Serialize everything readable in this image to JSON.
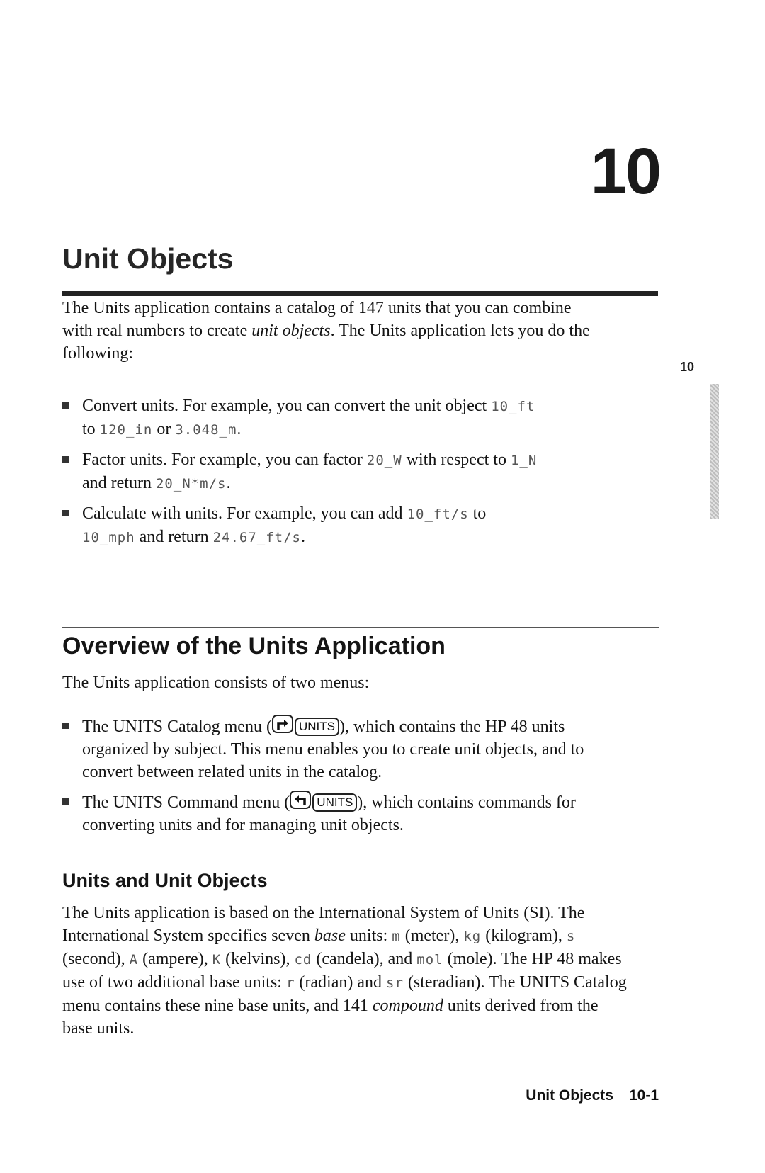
{
  "chapter": {
    "number": "10",
    "title": "Unit Objects"
  },
  "intro": {
    "part1": "The Units application contains a catalog of 147 units that you can combine with real numbers to create ",
    "emphasis": "unit objects",
    "part2": ". The Units application lets you do the following:"
  },
  "bullets": [
    {
      "t1": "Convert units. For example, you can convert the unit object ",
      "c1": "10_ft",
      "t2": " to ",
      "c2": "120_in",
      "t3": " or ",
      "c3": "3.048_m",
      "t4": "."
    },
    {
      "t1": "Factor units. For example, you can factor ",
      "c1": "20_W",
      "t2": " with respect to ",
      "c2": "1_N",
      "t3": " and return ",
      "c3": "20_N*m/s",
      "t4": "."
    },
    {
      "t1": "Calculate with units. For example, you can add ",
      "c1": "10_ft/s",
      "t2": " to ",
      "c2": "10_mph",
      "t3": " and return ",
      "c3": "24.67_ft/s",
      "t4": "."
    }
  ],
  "overview": {
    "heading": "Overview of the Units Application",
    "lead": "The Units application consists of two menus:",
    "menus": [
      {
        "pre": "The UNITS Catalog menu (",
        "shift_key": "right-shift-icon",
        "key_label": "UNITS",
        "post": "), which contains the HP 48 units organized by subject. This menu enables you to create unit objects, and to convert between related units in the catalog."
      },
      {
        "pre": "The UNITS Command menu (",
        "shift_key": "left-shift-icon",
        "key_label": "UNITS",
        "post": "), which contains commands for converting units and for managing unit objects."
      }
    ]
  },
  "units_section": {
    "heading": "Units and Unit Objects",
    "s1": "The Units application is based on the International System of Units (SI). The International System specifies seven ",
    "base_em": "base",
    "s2": " units: ",
    "u_m": "m",
    "s3": " (meter), ",
    "u_kg": "kg",
    "s4": " (kilogram), ",
    "u_s": "s",
    "s5": " (second), ",
    "u_A": "A",
    "s6": " (ampere), ",
    "u_K": "K",
    "s7": " (kelvins), ",
    "u_cd": "cd",
    "s8": " (candela), and ",
    "u_mol": "mol",
    "s9": " (mole). The HP 48 makes use of two additional base units: ",
    "u_r": "r",
    "s10": " (radian) and ",
    "u_sr": "sr",
    "s11": " (steradian). The UNITS Catalog menu contains these nine base units, and 141 ",
    "compound_em": "compound",
    "s12": " units derived from the base units."
  },
  "side_tab": {
    "label": "10"
  },
  "footer": {
    "title": "Unit Objects",
    "page": "10-1"
  }
}
